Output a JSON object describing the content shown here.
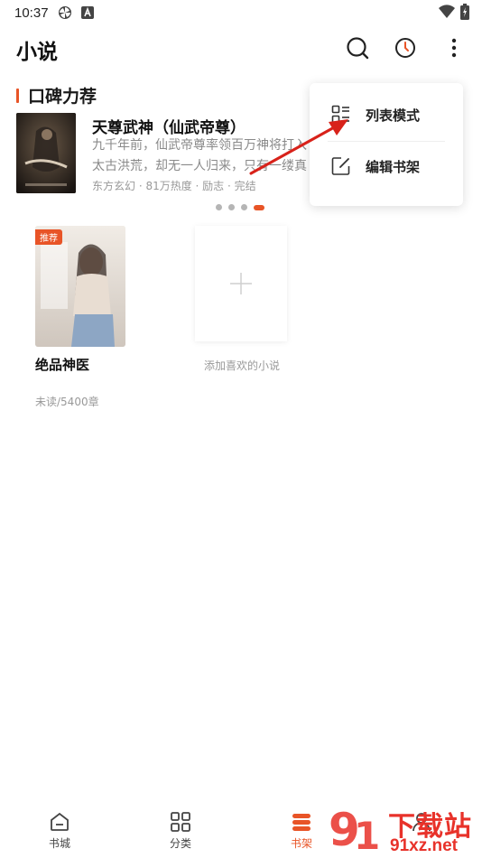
{
  "status_bar": {
    "time": "10:37",
    "left_icons": [
      "pinwheel-icon",
      "a-badge-icon"
    ],
    "right_icons": [
      "wifi-icon",
      "battery-charging-icon"
    ]
  },
  "header": {
    "title": "小说",
    "actions": [
      "search-icon",
      "history-clock-icon",
      "more-vertical-icon"
    ]
  },
  "recommend": {
    "section_title": "口碑力荐",
    "accent_color": "#e85427",
    "featured": {
      "title": "天尊武神（仙武帝尊）",
      "description": "九千年前，仙武帝尊率领百万神将打入太古洪荒，却无一人归来，只有一缕真火遗留世间。九千",
      "meta": "东方玄幻 · 81万热度 · 励志 · 完结"
    },
    "carousel": {
      "count": 4,
      "active_index": 3
    }
  },
  "shelf": {
    "books": [
      {
        "title": "绝品神医",
        "tag": "推荐",
        "progress": "未读/5400章"
      }
    ],
    "add_label": "添加喜欢的小说"
  },
  "popup_menu": {
    "items": [
      {
        "label": "列表模式",
        "icon": "list-mode-icon"
      },
      {
        "label": "编辑书架",
        "icon": "edit-icon"
      }
    ]
  },
  "bottom_nav": {
    "items": [
      {
        "label": "书城",
        "icon": "home-icon"
      },
      {
        "label": "分类",
        "icon": "category-grid-icon"
      },
      {
        "label": "书架",
        "icon": "bookshelf-icon",
        "active": true
      },
      {
        "label": "",
        "icon": "profile-icon"
      }
    ]
  },
  "watermark": {
    "text": "下载站",
    "url": "91xz.net"
  }
}
